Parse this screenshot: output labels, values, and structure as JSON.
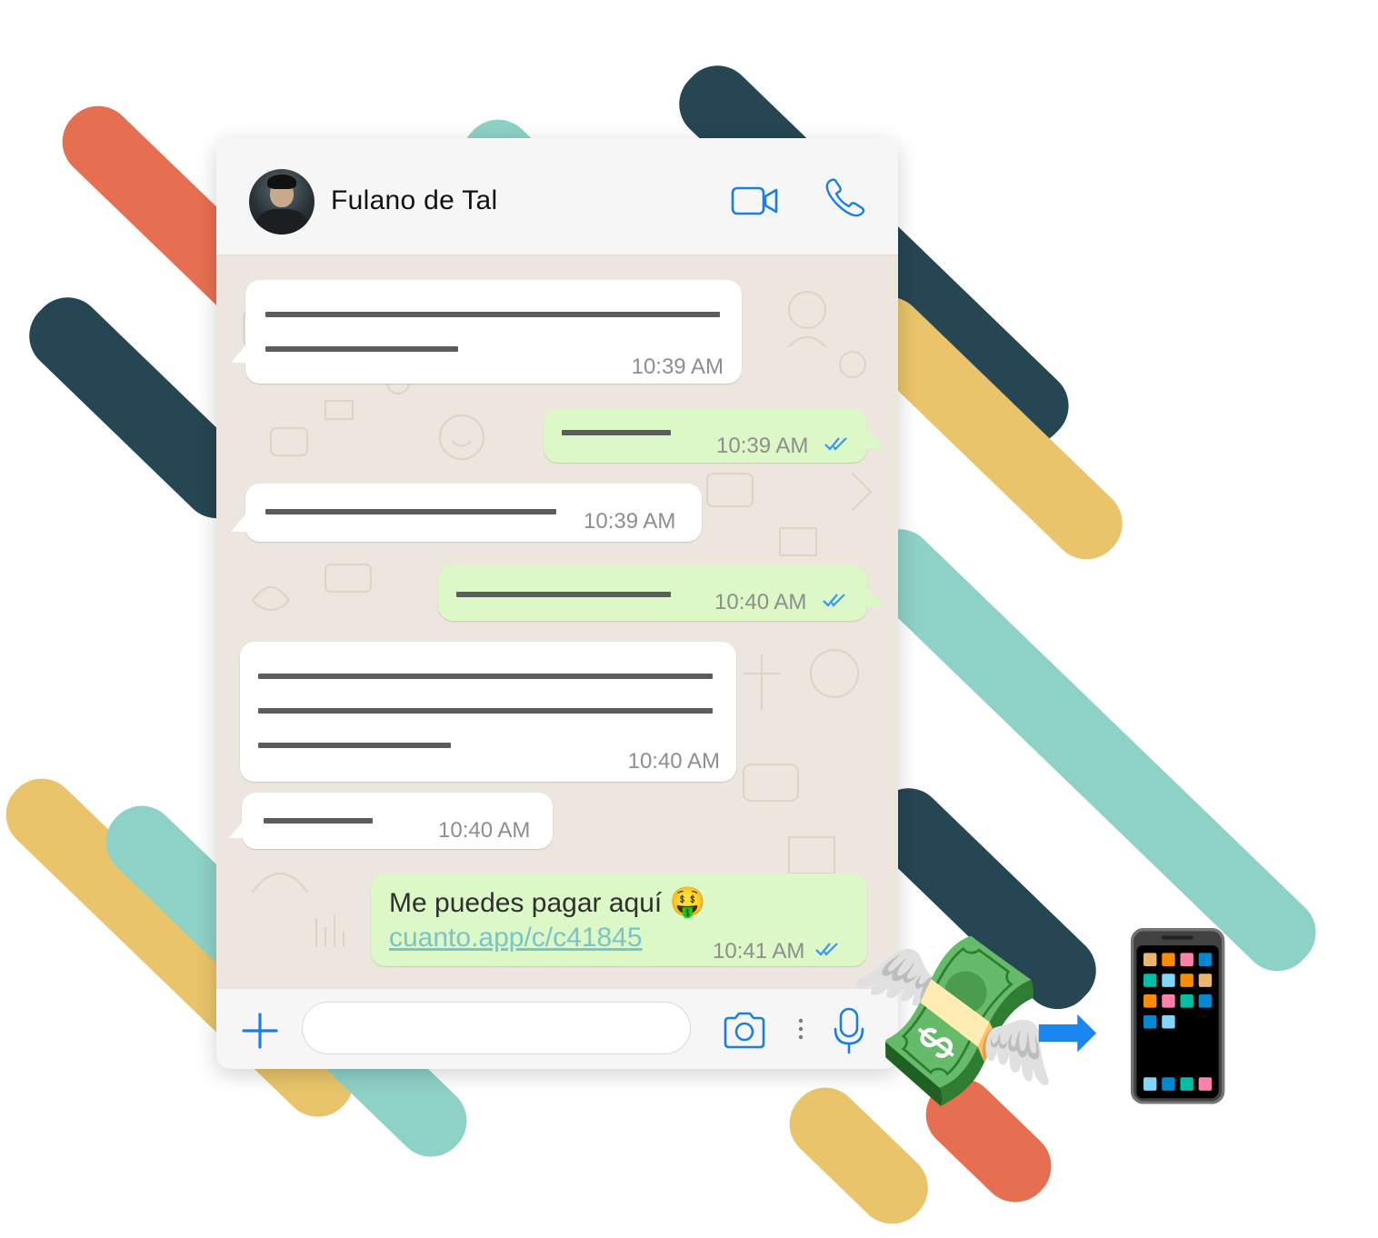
{
  "header": {
    "contact_name": "Fulano de Tal",
    "icons": [
      "video-call-icon",
      "phone-call-icon"
    ]
  },
  "messages": [
    {
      "direction": "incoming",
      "time": "10:39 AM",
      "redacted_lines": 2
    },
    {
      "direction": "outgoing",
      "time": "10:39 AM",
      "redacted_lines": 1,
      "status": "read"
    },
    {
      "direction": "incoming",
      "time": "10:39 AM",
      "redacted_lines": 1
    },
    {
      "direction": "outgoing",
      "time": "10:40 AM",
      "redacted_lines": 1,
      "status": "read"
    },
    {
      "direction": "incoming",
      "time": "10:40 AM",
      "redacted_lines": 3
    },
    {
      "direction": "incoming",
      "time": "10:40 AM",
      "redacted_lines": 1
    },
    {
      "direction": "outgoing",
      "time": "10:41 AM",
      "status": "read",
      "text": "Me puedes pagar aquí",
      "emoji": "🤑",
      "link": "cuanto.app/c/c41845"
    }
  ],
  "input_bar": {
    "placeholder": "",
    "icons": [
      "plus-icon",
      "camera-icon",
      "more-dots-icon",
      "microphone-icon"
    ]
  },
  "decoration": {
    "money_emoji": "💸",
    "arrow_emoji": "➡",
    "phone_emoji": "📱",
    "stripe_colors": [
      "#e76f51",
      "#264653",
      "#8ed1c6",
      "#e9c46a"
    ]
  },
  "colors": {
    "accent": "#1a7fe0",
    "incoming_bubble": "#ffffff",
    "outgoing_bubble": "#dcf8c6",
    "read_ticks": "#3497f9",
    "link": "#7cc3c9"
  }
}
